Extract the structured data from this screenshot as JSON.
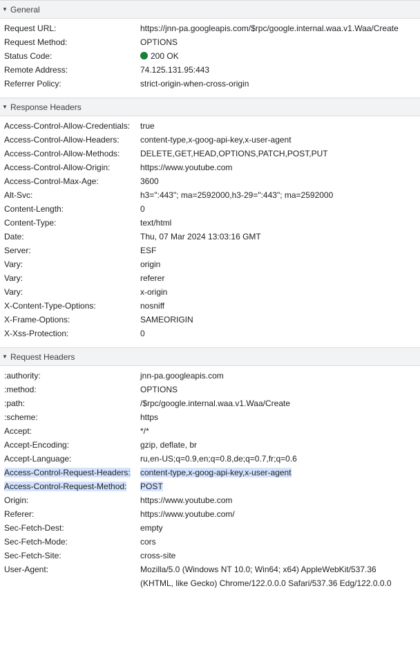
{
  "general": {
    "title": "General",
    "rows": [
      {
        "key": "Request URL:",
        "value": "https://jnn-pa.googleapis.com/$rpc/google.internal.waa.v1.Waa/Create"
      },
      {
        "key": "Request Method:",
        "value": "OPTIONS"
      },
      {
        "key": "Status Code:",
        "value": "200 OK"
      },
      {
        "key": "Remote Address:",
        "value": "74.125.131.95:443"
      },
      {
        "key": "Referrer Policy:",
        "value": "strict-origin-when-cross-origin"
      }
    ],
    "status_color": "#188038"
  },
  "response_headers": {
    "title": "Response Headers",
    "rows": [
      {
        "key": "Access-Control-Allow-Credentials:",
        "value": "true"
      },
      {
        "key": "Access-Control-Allow-Headers:",
        "value": "content-type,x-goog-api-key,x-user-agent"
      },
      {
        "key": "Access-Control-Allow-Methods:",
        "value": "DELETE,GET,HEAD,OPTIONS,PATCH,POST,PUT"
      },
      {
        "key": "Access-Control-Allow-Origin:",
        "value": "https://www.youtube.com"
      },
      {
        "key": "Access-Control-Max-Age:",
        "value": "3600"
      },
      {
        "key": "Alt-Svc:",
        "value": "h3=\":443\"; ma=2592000,h3-29=\":443\"; ma=2592000"
      },
      {
        "key": "Content-Length:",
        "value": "0"
      },
      {
        "key": "Content-Type:",
        "value": "text/html"
      },
      {
        "key": "Date:",
        "value": "Thu, 07 Mar 2024 13:03:16 GMT"
      },
      {
        "key": "Server:",
        "value": "ESF"
      },
      {
        "key": "Vary:",
        "value": "origin"
      },
      {
        "key": "Vary:",
        "value": "referer"
      },
      {
        "key": "Vary:",
        "value": "x-origin"
      },
      {
        "key": "X-Content-Type-Options:",
        "value": "nosniff"
      },
      {
        "key": "X-Frame-Options:",
        "value": "SAMEORIGIN"
      },
      {
        "key": "X-Xss-Protection:",
        "value": "0"
      }
    ]
  },
  "request_headers": {
    "title": "Request Headers",
    "rows": [
      {
        "key": ":authority:",
        "value": "jnn-pa.googleapis.com"
      },
      {
        "key": ":method:",
        "value": "OPTIONS"
      },
      {
        "key": ":path:",
        "value": "/$rpc/google.internal.waa.v1.Waa/Create"
      },
      {
        "key": ":scheme:",
        "value": "https"
      },
      {
        "key": "Accept:",
        "value": "*/*"
      },
      {
        "key": "Accept-Encoding:",
        "value": "gzip, deflate, br"
      },
      {
        "key": "Accept-Language:",
        "value": "ru,en-US;q=0.9,en;q=0.8,de;q=0.7,fr;q=0.6"
      },
      {
        "key": "Access-Control-Request-Headers:",
        "value": "content-type,x-goog-api-key,x-user-agent"
      },
      {
        "key": "Access-Control-Request-Method:",
        "value": "POST"
      },
      {
        "key": "Origin:",
        "value": "https://www.youtube.com"
      },
      {
        "key": "Referer:",
        "value": "https://www.youtube.com/"
      },
      {
        "key": "Sec-Fetch-Dest:",
        "value": "empty"
      },
      {
        "key": "Sec-Fetch-Mode:",
        "value": "cors"
      },
      {
        "key": "Sec-Fetch-Site:",
        "value": "cross-site"
      },
      {
        "key": "User-Agent:",
        "value": "Mozilla/5.0 (Windows NT 10.0; Win64; x64) AppleWebKit/537.36 (KHTML, like Gecko) Chrome/122.0.0.0 Safari/537.36 Edg/122.0.0.0"
      }
    ],
    "highlight_color": "#d3e3fd"
  },
  "icons": {
    "section_toggle": "triangle-down-icon",
    "status": "status-dot-icon"
  }
}
